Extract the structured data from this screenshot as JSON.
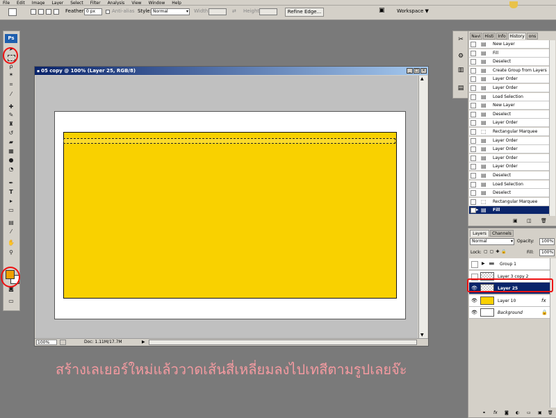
{
  "menu": [
    "File",
    "Edit",
    "Image",
    "Layer",
    "Select",
    "Filter",
    "Analysis",
    "View",
    "Window",
    "Help"
  ],
  "options_bar": {
    "feather_label": "Feather:",
    "feather_value": "0 px",
    "antialias_label": "Anti-alias",
    "style_label": "Style:",
    "style_value": "Normal",
    "width_label": "Width:",
    "height_label": "Height:",
    "refine_edge_label": "Refine Edge...",
    "workspace_label": "Workspace ▼"
  },
  "toolbox": {
    "logo": "Ps",
    "foreground_color": "#f0a000",
    "background_color": "#ffffff"
  },
  "document": {
    "title": "05 copy @ 100% (Layer 25, RGB/8)",
    "zoom": "100%",
    "doc_info": "Doc: 1.11M/17.7M",
    "fill_color": "#f9d100"
  },
  "history_panel": {
    "tabs": [
      "Navi",
      "Histi",
      "Info",
      "History",
      "ons"
    ],
    "active_tab": "History",
    "items": [
      {
        "label": "New Layer",
        "selected": false
      },
      {
        "label": "Fill",
        "selected": false
      },
      {
        "label": "Deselect",
        "selected": false
      },
      {
        "label": "Create Group from Layers",
        "selected": false
      },
      {
        "label": "Layer Order",
        "selected": false
      },
      {
        "label": "Layer Order",
        "selected": false
      },
      {
        "label": "Load Selection",
        "selected": false
      },
      {
        "label": "New Layer",
        "selected": false
      },
      {
        "label": "Deselect",
        "selected": false
      },
      {
        "label": "Layer Order",
        "selected": false
      },
      {
        "label": "Rectangular Marquee",
        "selected": false
      },
      {
        "label": "Layer Order",
        "selected": false
      },
      {
        "label": "Layer Order",
        "selected": false
      },
      {
        "label": "Layer Order",
        "selected": false
      },
      {
        "label": "Layer Order",
        "selected": false
      },
      {
        "label": "Deselect",
        "selected": false
      },
      {
        "label": "Load Selection",
        "selected": false
      },
      {
        "label": "Deselect",
        "selected": false
      },
      {
        "label": "Rectangular Marquee",
        "selected": false
      },
      {
        "label": "Fill",
        "selected": true
      }
    ]
  },
  "layers_panel": {
    "tabs": [
      "Layers",
      "Channels"
    ],
    "blend_mode": "Normal",
    "opacity_label": "Opacity:",
    "opacity_value": "100%",
    "lock_label": "Lock:",
    "fill_label": "Fill:",
    "fill_value": "100%",
    "layers": [
      {
        "name": "Group 1",
        "type": "group",
        "selected": false,
        "visible": false
      },
      {
        "name": "Layer 3 copy 2",
        "type": "layer",
        "selected": false,
        "visible": false
      },
      {
        "name": "Layer 25",
        "type": "layer",
        "selected": true,
        "visible": true
      },
      {
        "name": "Layer 10",
        "type": "layer",
        "selected": false,
        "visible": true,
        "fx": "fx"
      },
      {
        "name": "Background",
        "type": "background",
        "selected": false,
        "visible": true
      }
    ]
  },
  "caption": "สร้างเลเยอร์ใหม่แล้ววาดเส้นสี่เหลี่ยมลงไปเทสีตามรูปเลยจ๊ะ"
}
